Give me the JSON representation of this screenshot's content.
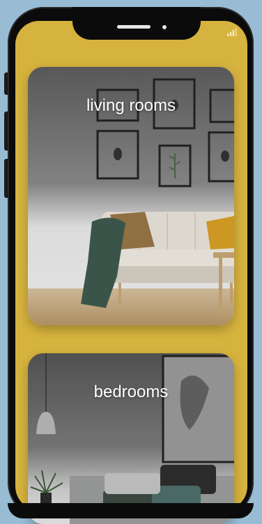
{
  "categories": [
    {
      "label": "living rooms"
    },
    {
      "label": "bedrooms"
    }
  ],
  "colors": {
    "background": "#98bcd4",
    "screen": "#d6b23e",
    "bezel": "#0b0b0b",
    "label": "#ffffff"
  },
  "icons": {
    "status": "signal-icon"
  }
}
